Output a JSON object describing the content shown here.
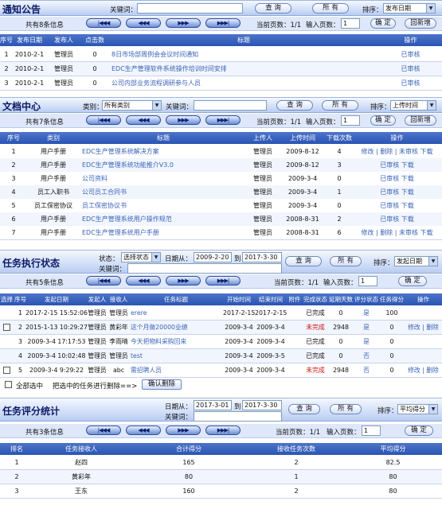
{
  "common": {
    "keyword_label": "关键词：",
    "query_btn": "查 询",
    "all_btn": "所 有",
    "sort_label": "排序：",
    "confirm_btn": "确 定",
    "back_add_btn": "回新增",
    "page_input_label": "输入页数：",
    "page_input_value": "1",
    "pager_first": "|◀◀◀",
    "pager_prev": "◀◀◀",
    "pager_next": "▶▶▶",
    "pager_last": "▶▶▶|"
  },
  "notice": {
    "title": "通知公告",
    "sort_value": "发布日期",
    "count_text": "共有8条信息",
    "current_page": "当前页数：1/1",
    "columns": [
      "序号",
      "发布日期",
      "发布人",
      "点击数",
      "标题",
      "操作"
    ],
    "rows": [
      {
        "no": "1",
        "date": "2010-2-1",
        "author": "管理员",
        "clicks": "0",
        "title": "8日市场部周例会会议时间通知",
        "op": "已审核"
      },
      {
        "no": "2",
        "date": "2010-2-1",
        "author": "管理员",
        "clicks": "0",
        "title": "EDC生产管理软件系统操作培训时间安排",
        "op": "已审核"
      },
      {
        "no": "3",
        "date": "2010-2-1",
        "author": "管理员",
        "clicks": "0",
        "title": "公司内部业务流程调研参与人员",
        "op": "已审核"
      }
    ]
  },
  "docs": {
    "title": "文档中心",
    "category_label": "类别：",
    "category_value": "所有类别",
    "sort_value": "上传时间",
    "count_text": "共有7条信息",
    "current_page": "当前页数：1/1",
    "columns": [
      "序号",
      "类别",
      "标题",
      "上传人",
      "上传时间",
      "下载次数",
      "操作"
    ],
    "rows": [
      {
        "no": "1",
        "cat": "用户手册",
        "title": "EDC生产管理系统解决方案",
        "uploader": "管理员",
        "time": "2009-8-12",
        "dl": "4",
        "op": "修改 | 删除 | 未审核 下载"
      },
      {
        "no": "2",
        "cat": "用户手册",
        "title": "EDC生产管理系统功能推介V3.0",
        "uploader": "管理员",
        "time": "2009-8-12",
        "dl": "3",
        "op": "已审核 下载"
      },
      {
        "no": "3",
        "cat": "用户手册",
        "title": "公司资料",
        "uploader": "管理员",
        "time": "2009-3-4",
        "dl": "0",
        "op": "已审核 下载"
      },
      {
        "no": "4",
        "cat": "员工入职书",
        "title": "公司员工合同书",
        "uploader": "管理员",
        "time": "2009-3-4",
        "dl": "1",
        "op": "已审核 下载"
      },
      {
        "no": "5",
        "cat": "员工保密协议",
        "title": "员工保密协议书",
        "uploader": "管理员",
        "time": "2009-3-4",
        "dl": "0",
        "op": "已审核 下载"
      },
      {
        "no": "6",
        "cat": "用户手册",
        "title": "EDC生产管理系统用户操作规范",
        "uploader": "管理员",
        "time": "2008-8-31",
        "dl": "2",
        "op": "已审核 下载"
      },
      {
        "no": "7",
        "cat": "用户手册",
        "title": "EDC生产管理系统用户手册",
        "uploader": "管理员",
        "time": "2008-8-31",
        "dl": "6",
        "op": "修改 | 删除 | 未审核 下载"
      }
    ]
  },
  "tasks": {
    "title": "任务执行状态",
    "status_label": "状态：",
    "status_value": "选择状态",
    "date_from_label": "日期从：",
    "date_from": "2009-2-20",
    "date_to_label": "到",
    "date_to": "2017-3-30",
    "sort_value": "发起日期",
    "count_text": "共有5条信息",
    "current_page": "当前页数：1/1",
    "columns": [
      "选择",
      "序号",
      "发起日期",
      "发起人",
      "接收人",
      "任务标题",
      "开始时间",
      "结束时间",
      "附件",
      "完成状态",
      "延期天数",
      "评分状态",
      "任务得分",
      "操作"
    ],
    "rows": [
      {
        "check": false,
        "no": "1",
        "date": "2017-2-15 15:52:06",
        "from": "管理员",
        "to": "管理员",
        "title": "erere",
        "start": "2017-2-15",
        "end": "2017-2-15",
        "att": "",
        "state": "已完成",
        "delay": "0",
        "scored": "是",
        "score": "100",
        "op": ""
      },
      {
        "check": true,
        "no": "2",
        "date": "2015-1-13 10:29:27",
        "from": "管理员",
        "to": "黄彩年",
        "title": "这个月做20000业绩",
        "start": "2009-3-4",
        "end": "2009-3-4",
        "att": "",
        "state": "未完成",
        "delay": "2948",
        "scored": "是",
        "score": "0",
        "op": "修改 | 删除"
      },
      {
        "check": false,
        "no": "3",
        "date": "2009-3-4 17:17:53",
        "from": "管理员",
        "to": "李雨晴",
        "title": "今天把物料采购回来",
        "start": "2009-3-4",
        "end": "2009-3-4",
        "att": "",
        "state": "已完成",
        "delay": "0",
        "scored": "是",
        "score": "0",
        "op": ""
      },
      {
        "check": false,
        "no": "4",
        "date": "2009-3-4 10:02:48",
        "from": "管理员",
        "to": "管理员",
        "title": "test",
        "start": "2009-3-4",
        "end": "2009-3-5",
        "att": "",
        "state": "已完成",
        "delay": "0",
        "scored": "否",
        "score": "0",
        "op": ""
      },
      {
        "check": true,
        "no": "5",
        "date": "2009-3-4 9:29:22",
        "from": "管理员",
        "to": "abc",
        "title": "需招聘人员",
        "start": "2009-3-4",
        "end": "2009-3-4",
        "att": "",
        "state": "未完成",
        "delay": "2948",
        "scored": "否",
        "score": "0",
        "op": "修改 | 删除"
      }
    ],
    "select_all_label": "全部选中",
    "delete_hint": "把选中的任务进行删除==>",
    "confirm_delete_btn": "确认删除"
  },
  "scores": {
    "title": "任务评分统计",
    "date_from_label": "日期从：",
    "date_from": "2017-3-01",
    "date_to_label": "到",
    "date_to": "2017-3-30",
    "sort_value": "平均得分",
    "count_text": "共有3条信息",
    "current_page": "当前页数：1/1",
    "columns": [
      "排名",
      "任务接收人",
      "合计得分",
      "接收任务次数",
      "平均得分"
    ],
    "rows": [
      {
        "rank": "1",
        "name": "赵四",
        "total": "165",
        "times": "2",
        "avg": "82.5"
      },
      {
        "rank": "2",
        "name": "黄彩年",
        "total": "80",
        "times": "1",
        "avg": "80"
      },
      {
        "rank": "3",
        "name": "王东",
        "total": "160",
        "times": "2",
        "avg": "80"
      }
    ]
  }
}
